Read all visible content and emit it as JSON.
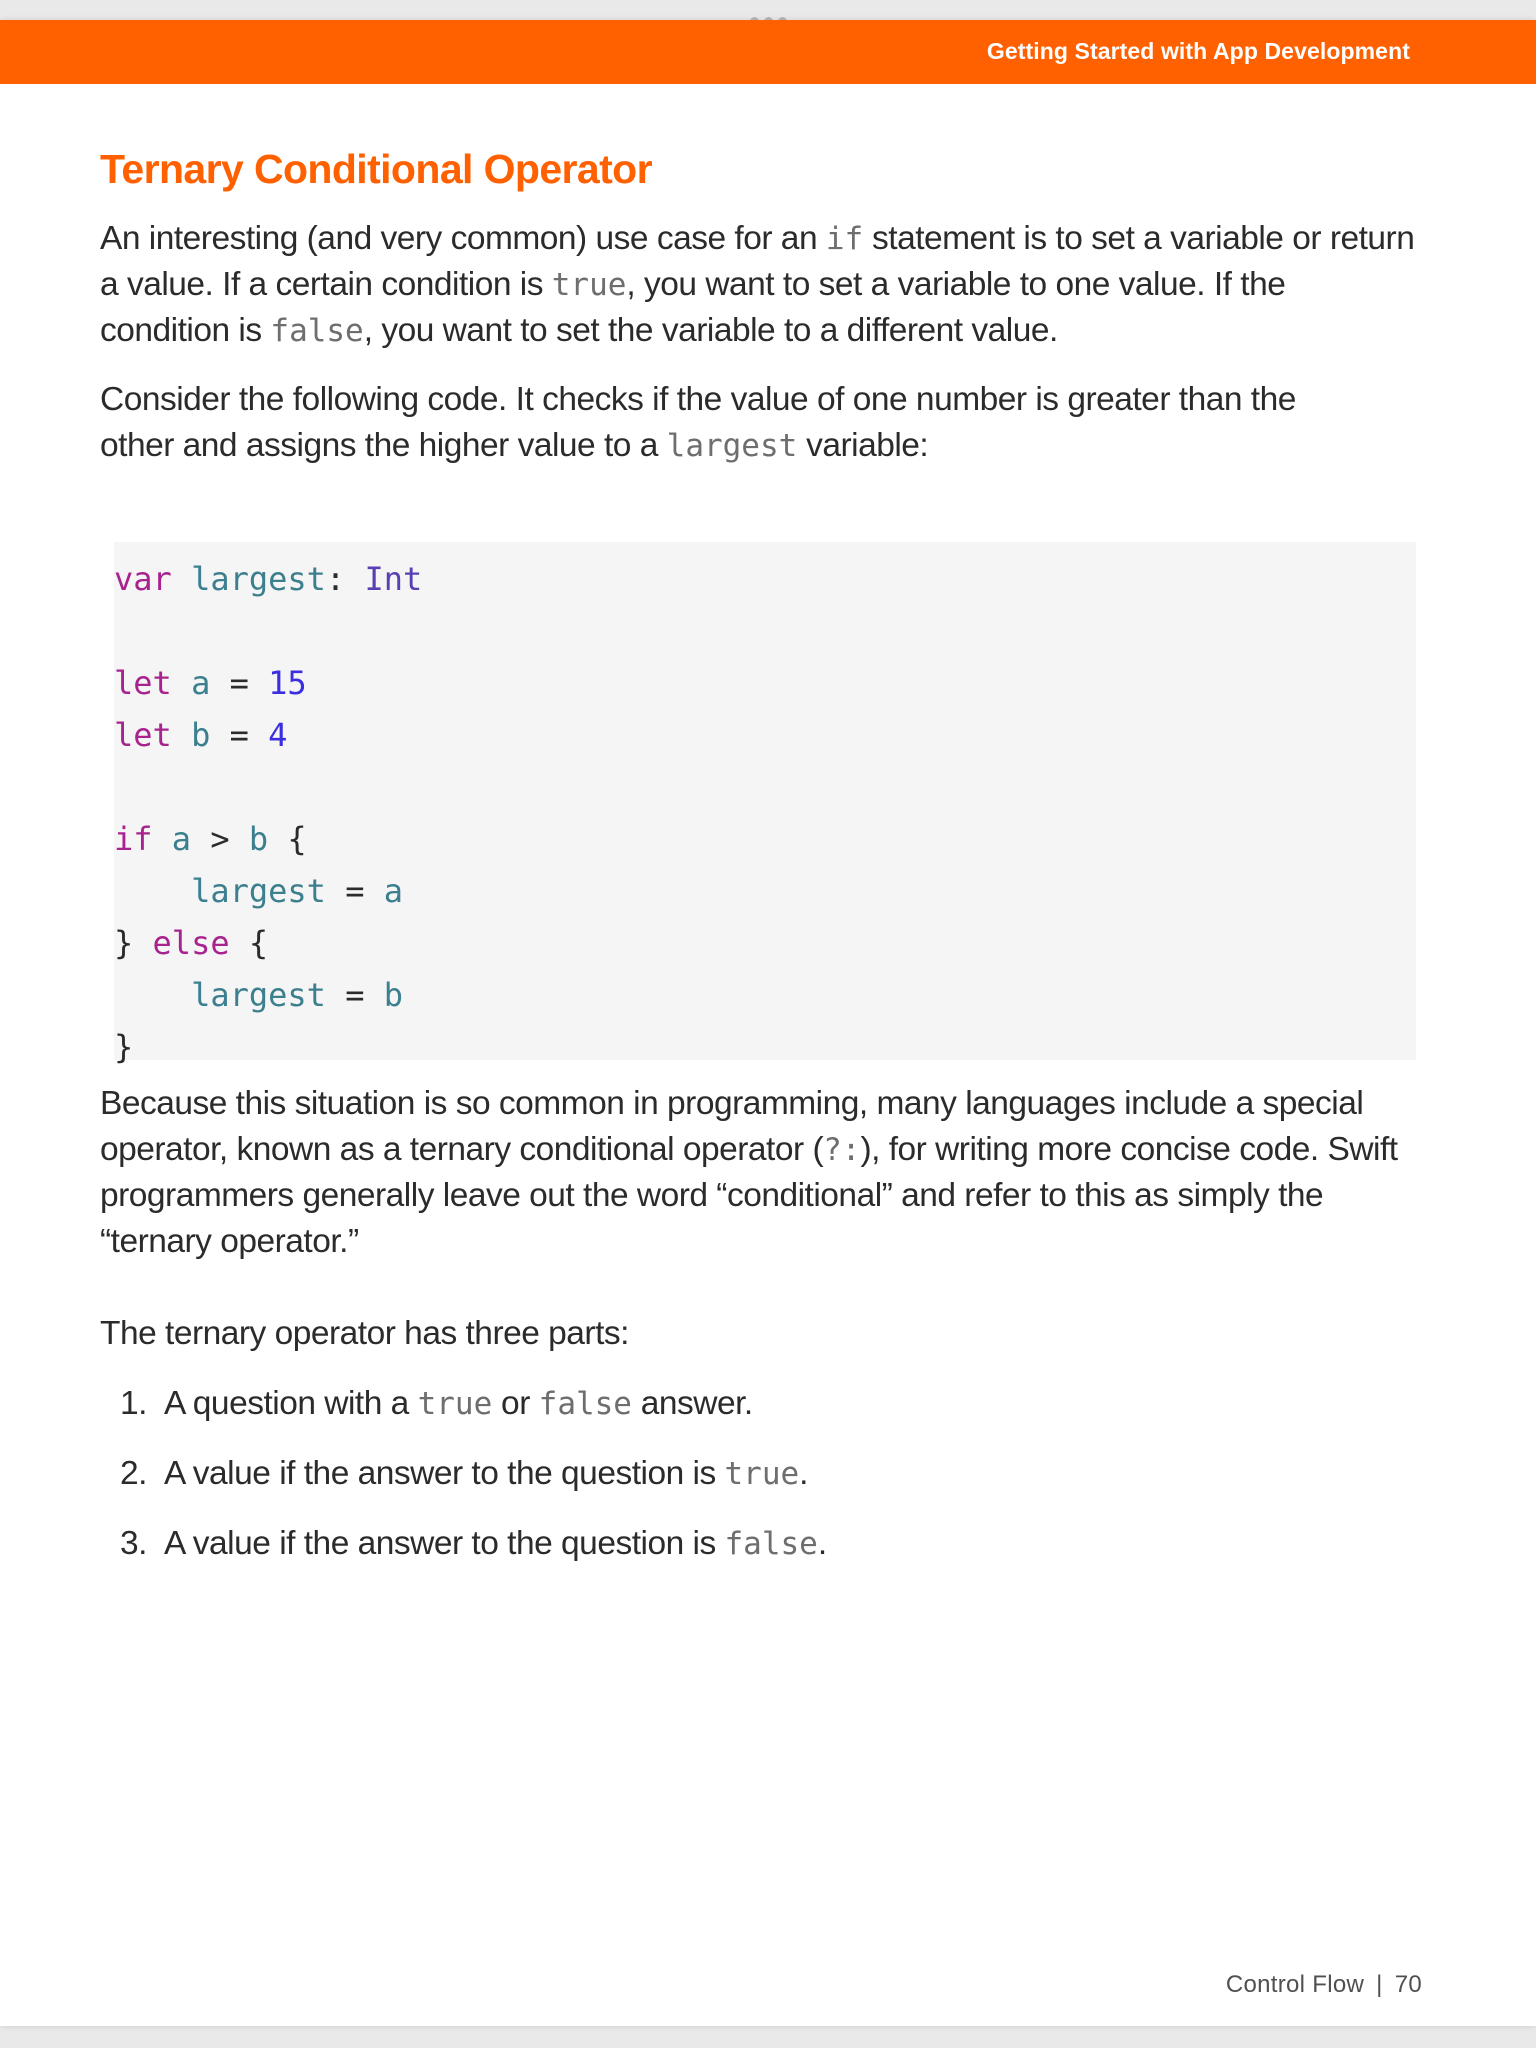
{
  "header": {
    "banner_title": "Getting Started with App Development",
    "brand_color": "#ff6000"
  },
  "section_title": "Ternary Conditional Operator",
  "para1": {
    "a": "An interesting (and very common) use case for an ",
    "code_if": "if",
    "b": " statement is to set a variable or return a value. If a certain condition is ",
    "code_true": "true",
    "c": ", you want to set a variable to one value. If the condition is ",
    "code_false": "false",
    "d": ", you want to set the variable to a different value."
  },
  "para2": {
    "a": "Consider the following code. It checks if the value of one number is greater than the other and assigns the higher value to a ",
    "code_largest": "largest",
    "b": " variable:"
  },
  "code": {
    "l1": {
      "kw": "var",
      "name": "largest",
      "colon": ":",
      "type": "Int"
    },
    "l2": {
      "kw": "let",
      "name": "a",
      "eq": "=",
      "num": "15"
    },
    "l3": {
      "kw": "let",
      "name": "b",
      "eq": "=",
      "num": "4"
    },
    "l4": {
      "kw": "if",
      "a": "a",
      "op": ">",
      "b": "b",
      "brace": "{"
    },
    "l5": {
      "name": "largest",
      "eq": "=",
      "val": "a"
    },
    "l6": {
      "close": "}",
      "kw": "else",
      "brace": "{"
    },
    "l7": {
      "name": "largest",
      "eq": "=",
      "val": "b"
    },
    "l8": {
      "close": "}"
    }
  },
  "para3": {
    "a": "Because this situation is so common in programming, many languages include a special operator, known as a ternary conditional operator (",
    "code_op": "?:",
    "b": "), for writing more concise code. Swift programmers generally leave out the word “conditional” and refer to this as simply the “ternary operator.”"
  },
  "para4": "The ternary operator has three parts:",
  "list": [
    {
      "num": "1.",
      "a": "A question with a ",
      "code1": "true",
      "b": " or ",
      "code2": "false",
      "c": " answer."
    },
    {
      "num": "2.",
      "a": "A value if the answer to the question is ",
      "code1": "true",
      "b": "."
    },
    {
      "num": "3.",
      "a": "A value if the answer to the question is ",
      "code1": "false",
      "b": "."
    }
  ],
  "footer": {
    "chapter": "Control Flow",
    "separator": "|",
    "page": "70"
  }
}
